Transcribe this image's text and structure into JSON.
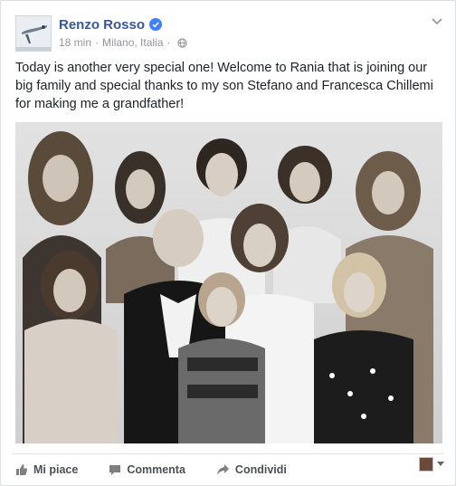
{
  "post": {
    "author": "Renzo Rosso",
    "time": "18 min",
    "location": "Milano, Italia",
    "separator": "·",
    "text": "Today is another very special one! Welcome to Rania that is joining our big family and special thanks to my son Stefano and Francesca Chillemi for making me a grandfather!"
  },
  "actions": {
    "like": "Mi piace",
    "comment": "Commenta",
    "share": "Condividi"
  },
  "colors": {
    "author_link": "#365899",
    "verified_badge": "#4080ff",
    "meta_text": "#90949c",
    "action_text": "#4b4f56"
  },
  "icons": [
    "verified-badge-icon",
    "globe-icon",
    "chevron-down-icon",
    "like-thumb-icon",
    "comment-icon",
    "share-arrow-icon",
    "dropdown-caret-icon"
  ]
}
